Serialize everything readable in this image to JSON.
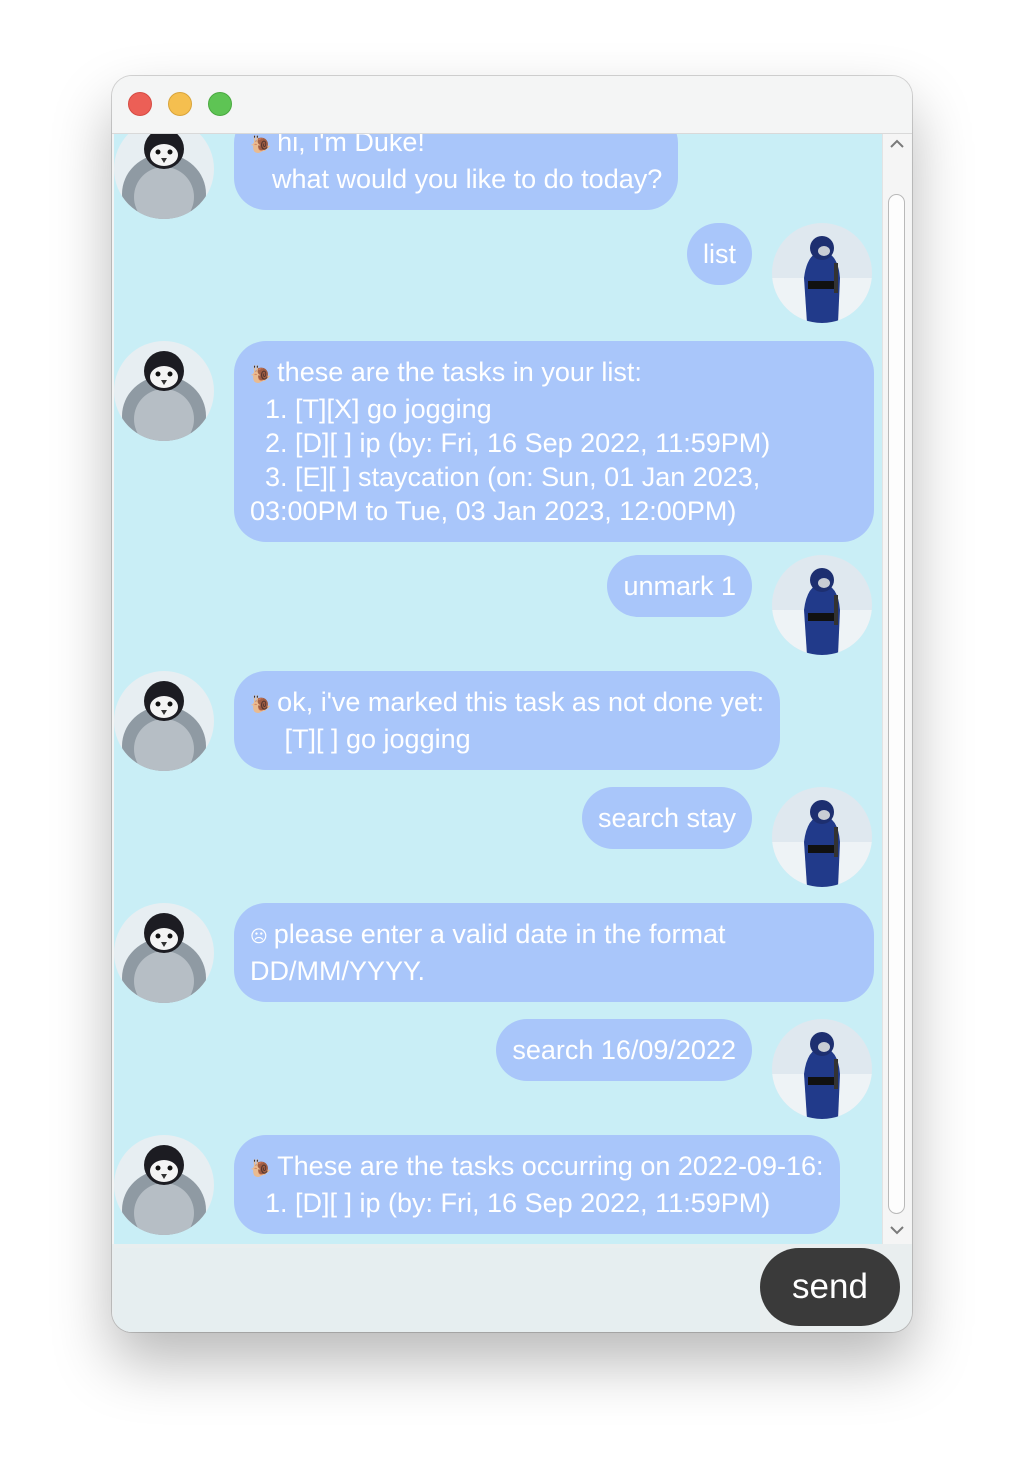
{
  "window": {
    "controls": [
      "close",
      "minimize",
      "zoom"
    ]
  },
  "messages": [
    {
      "sender": "bot",
      "icon": "snail-icon",
      "lines": [
        "hi, i'm Duke!",
        "what would you like to do today?"
      ]
    },
    {
      "sender": "user",
      "text": "list"
    },
    {
      "sender": "bot",
      "icon": "snail-icon",
      "lines": [
        "these are the tasks in your list:",
        "  1. [T][X] go jogging",
        "  2. [D][ ] ip (by: Fri, 16 Sep 2022, 11:59PM)",
        "  3. [E][ ] staycation (on: Sun, 01 Jan 2023,",
        "03:00PM to Tue, 03 Jan 2023, 12:00PM)"
      ]
    },
    {
      "sender": "user",
      "text": "unmark 1"
    },
    {
      "sender": "bot",
      "icon": "snail-icon",
      "lines": [
        "ok, i've marked this task as not done yet:",
        "   [T][ ] go jogging"
      ]
    },
    {
      "sender": "user",
      "text": "search stay"
    },
    {
      "sender": "bot",
      "icon": "sad-face-icon",
      "lines": [
        "please enter a valid date in the format",
        "DD/MM/YYYY."
      ]
    },
    {
      "sender": "user",
      "text": "search 16/09/2022"
    },
    {
      "sender": "bot",
      "icon": "snail-icon",
      "lines": [
        "These are the tasks occurring on 2022-09-16:",
        "  1. [D][ ] ip (by: Fri, 16 Sep 2022, 11:59PM)"
      ]
    }
  ],
  "input": {
    "value": "",
    "placeholder": ""
  },
  "send_label": "send",
  "colors": {
    "chat_background": "#c9eef6",
    "bubble": "#a9c6fa",
    "send_button": "#3a3a3a"
  }
}
